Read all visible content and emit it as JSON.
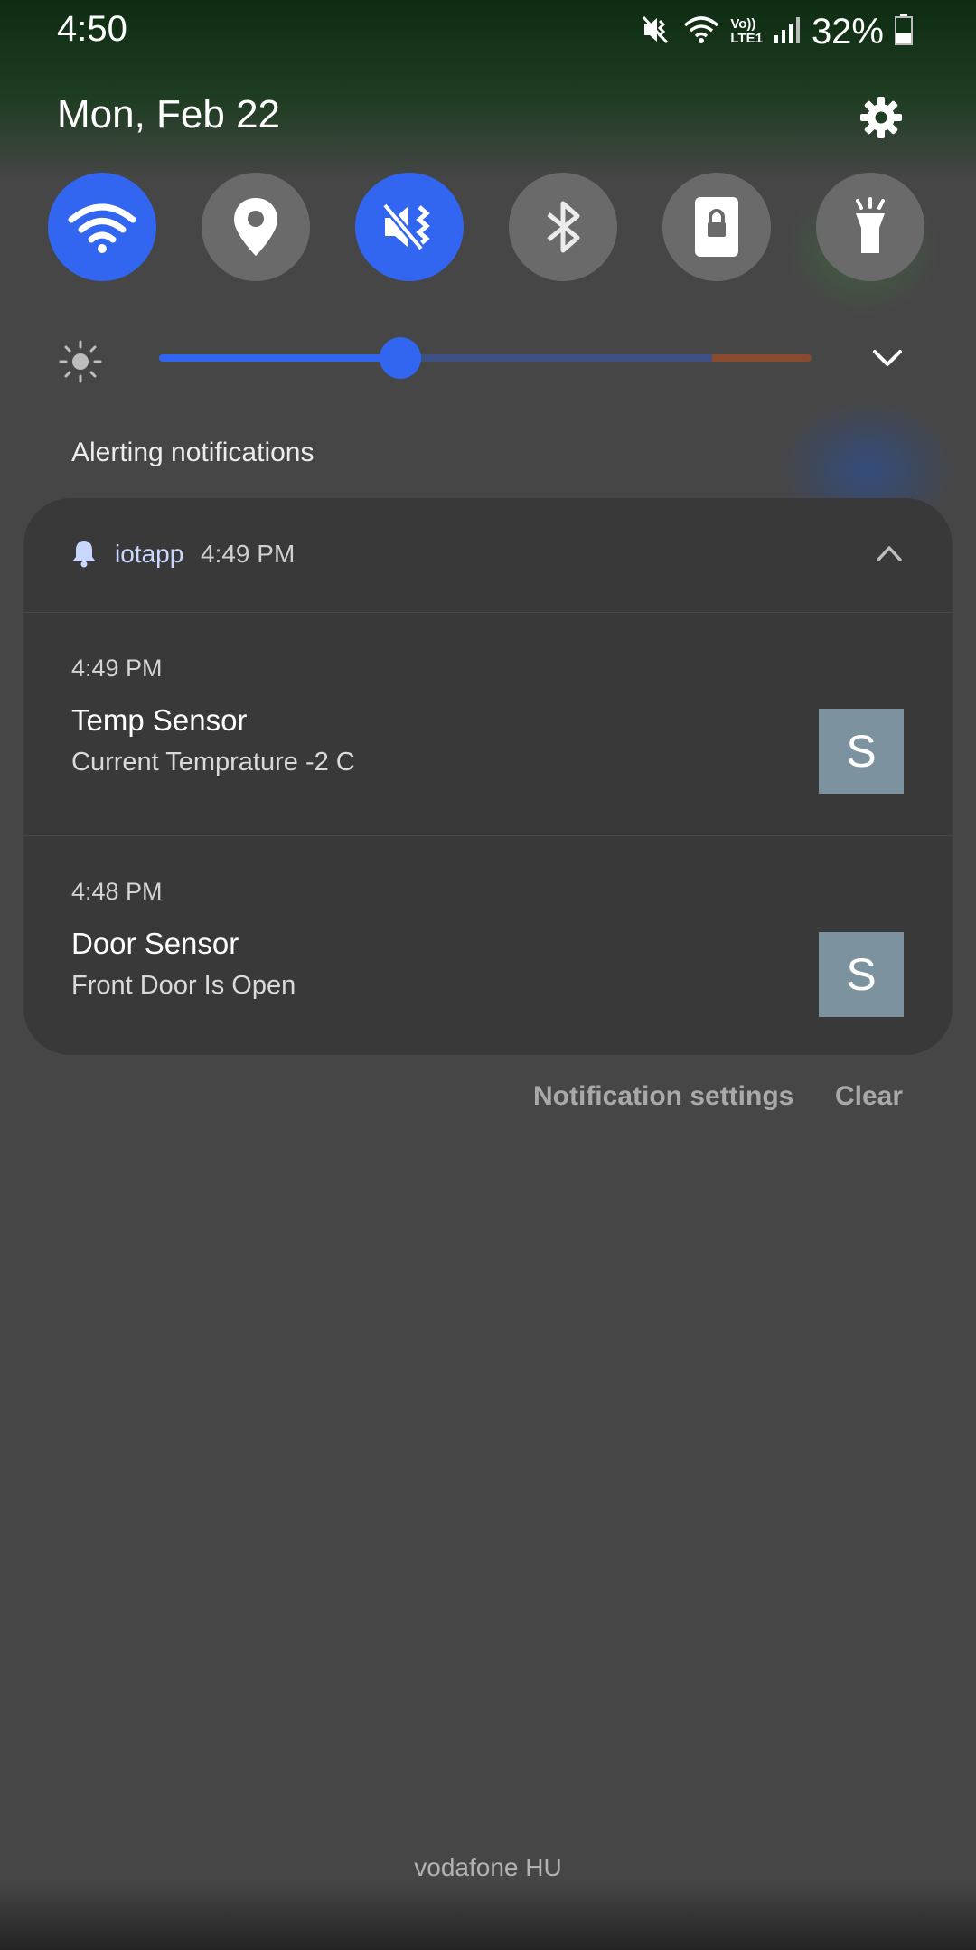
{
  "status_bar": {
    "time": "4:50",
    "battery_percent": "32%",
    "network_label_top": "Vo))",
    "network_label_bottom": "LTE1",
    "icons": [
      "mute-vibrate-icon",
      "wifi-icon",
      "volte-icon",
      "signal-icon",
      "battery-icon"
    ]
  },
  "header": {
    "date": "Mon, Feb 22",
    "settings_icon": "gear-icon"
  },
  "quick_toggles": [
    {
      "icon": "wifi-icon",
      "state": "on"
    },
    {
      "icon": "location-icon",
      "state": "off"
    },
    {
      "icon": "sound-mute-icon",
      "state": "on"
    },
    {
      "icon": "bluetooth-icon",
      "state": "off"
    },
    {
      "icon": "screen-lock-icon",
      "state": "off"
    },
    {
      "icon": "flashlight-icon",
      "state": "off"
    }
  ],
  "brightness": {
    "level_fraction": 0.37,
    "icon": "brightness-icon"
  },
  "notifications": {
    "section_label": "Alerting notifications",
    "group": {
      "app_name": "iotapp",
      "time": "4:49 PM",
      "items": [
        {
          "time": "4:49 PM",
          "title": "Temp Sensor",
          "text": "Current Temprature -2 C",
          "avatar_letter": "S"
        },
        {
          "time": "4:48 PM",
          "title": "Door Sensor",
          "text": "Front Door Is Open",
          "avatar_letter": "S"
        }
      ]
    },
    "actions": {
      "settings_label": "Notification settings",
      "clear_label": "Clear"
    }
  },
  "footer": {
    "carrier": "vodafone HU"
  },
  "colors": {
    "accent": "#3266f0",
    "panel_bg": "#464646",
    "card_bg": "#393939",
    "toggle_off": "#6a6a6a",
    "avatar_bg": "#7c929f"
  }
}
